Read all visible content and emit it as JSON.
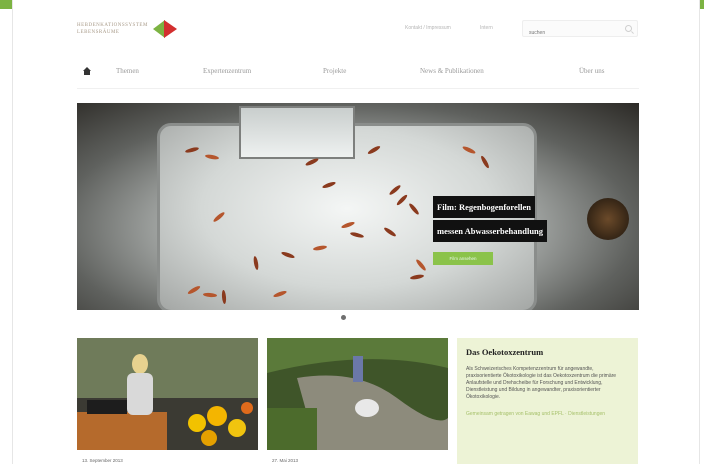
{
  "header": {
    "logo_text": [
      "HEBDENKATIONSSYSTEM",
      "LEBENSRÄUME"
    ],
    "util_links": [
      "Kontakt / Impressum",
      "Intern"
    ],
    "search": {
      "placeholder": "suchen"
    }
  },
  "nav": {
    "items": [
      "Themen",
      "Expertenzentrum",
      "Projekte",
      "News & Publikationen",
      "Über uns"
    ]
  },
  "hero": {
    "caption_line1": "Film: Regenbogenforellen",
    "caption_line2": "messen Abwasserbehandlung",
    "button_label": "Film ansehen"
  },
  "teasers": [
    {
      "date": "13. September 2013"
    },
    {
      "date": "27. Mai 2013"
    }
  ],
  "info": {
    "title": "Das Oekotoxzentrum",
    "body": "Als Schweizerisches Kompetenzzentrum für angewandte, praxisorientierte Ökotoxikologie ist das Oekotoxzentrum die primäre Anlaufstelle und Drehscheibe für Forschung und Entwicklung, Dienstleistung und Bildung in angewandter, praxisorientierter Ökotoxikologie.",
    "link": "Gemeinsam getragen von Eawag und EPFL · Dienstleistungen"
  },
  "colors": {
    "accent_green": "#7cb342",
    "accent_red": "#d32f2f",
    "info_bg": "#edf3d6"
  }
}
